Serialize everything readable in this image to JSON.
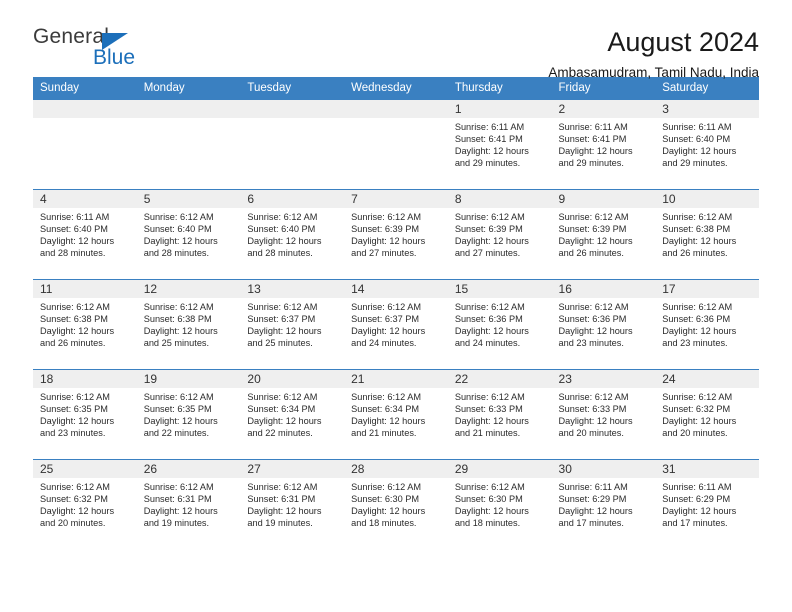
{
  "brand": {
    "name_part1": "General",
    "name_part2": "Blue",
    "accent_color": "#1c6fba"
  },
  "header": {
    "title": "August 2024",
    "location": "Ambasamudram, Tamil Nadu, India"
  },
  "calendar": {
    "header_color": "#3a80c1",
    "weekday_headers": [
      "Sunday",
      "Monday",
      "Tuesday",
      "Wednesday",
      "Thursday",
      "Friday",
      "Saturday"
    ],
    "weeks": [
      [
        {
          "day": "",
          "sunrise": "",
          "sunset": "",
          "daylight1": "",
          "daylight2": ""
        },
        {
          "day": "",
          "sunrise": "",
          "sunset": "",
          "daylight1": "",
          "daylight2": ""
        },
        {
          "day": "",
          "sunrise": "",
          "sunset": "",
          "daylight1": "",
          "daylight2": ""
        },
        {
          "day": "",
          "sunrise": "",
          "sunset": "",
          "daylight1": "",
          "daylight2": ""
        },
        {
          "day": "1",
          "sunrise": "Sunrise: 6:11 AM",
          "sunset": "Sunset: 6:41 PM",
          "daylight1": "Daylight: 12 hours",
          "daylight2": "and 29 minutes."
        },
        {
          "day": "2",
          "sunrise": "Sunrise: 6:11 AM",
          "sunset": "Sunset: 6:41 PM",
          "daylight1": "Daylight: 12 hours",
          "daylight2": "and 29 minutes."
        },
        {
          "day": "3",
          "sunrise": "Sunrise: 6:11 AM",
          "sunset": "Sunset: 6:40 PM",
          "daylight1": "Daylight: 12 hours",
          "daylight2": "and 29 minutes."
        }
      ],
      [
        {
          "day": "4",
          "sunrise": "Sunrise: 6:11 AM",
          "sunset": "Sunset: 6:40 PM",
          "daylight1": "Daylight: 12 hours",
          "daylight2": "and 28 minutes."
        },
        {
          "day": "5",
          "sunrise": "Sunrise: 6:12 AM",
          "sunset": "Sunset: 6:40 PM",
          "daylight1": "Daylight: 12 hours",
          "daylight2": "and 28 minutes."
        },
        {
          "day": "6",
          "sunrise": "Sunrise: 6:12 AM",
          "sunset": "Sunset: 6:40 PM",
          "daylight1": "Daylight: 12 hours",
          "daylight2": "and 28 minutes."
        },
        {
          "day": "7",
          "sunrise": "Sunrise: 6:12 AM",
          "sunset": "Sunset: 6:39 PM",
          "daylight1": "Daylight: 12 hours",
          "daylight2": "and 27 minutes."
        },
        {
          "day": "8",
          "sunrise": "Sunrise: 6:12 AM",
          "sunset": "Sunset: 6:39 PM",
          "daylight1": "Daylight: 12 hours",
          "daylight2": "and 27 minutes."
        },
        {
          "day": "9",
          "sunrise": "Sunrise: 6:12 AM",
          "sunset": "Sunset: 6:39 PM",
          "daylight1": "Daylight: 12 hours",
          "daylight2": "and 26 minutes."
        },
        {
          "day": "10",
          "sunrise": "Sunrise: 6:12 AM",
          "sunset": "Sunset: 6:38 PM",
          "daylight1": "Daylight: 12 hours",
          "daylight2": "and 26 minutes."
        }
      ],
      [
        {
          "day": "11",
          "sunrise": "Sunrise: 6:12 AM",
          "sunset": "Sunset: 6:38 PM",
          "daylight1": "Daylight: 12 hours",
          "daylight2": "and 26 minutes."
        },
        {
          "day": "12",
          "sunrise": "Sunrise: 6:12 AM",
          "sunset": "Sunset: 6:38 PM",
          "daylight1": "Daylight: 12 hours",
          "daylight2": "and 25 minutes."
        },
        {
          "day": "13",
          "sunrise": "Sunrise: 6:12 AM",
          "sunset": "Sunset: 6:37 PM",
          "daylight1": "Daylight: 12 hours",
          "daylight2": "and 25 minutes."
        },
        {
          "day": "14",
          "sunrise": "Sunrise: 6:12 AM",
          "sunset": "Sunset: 6:37 PM",
          "daylight1": "Daylight: 12 hours",
          "daylight2": "and 24 minutes."
        },
        {
          "day": "15",
          "sunrise": "Sunrise: 6:12 AM",
          "sunset": "Sunset: 6:36 PM",
          "daylight1": "Daylight: 12 hours",
          "daylight2": "and 24 minutes."
        },
        {
          "day": "16",
          "sunrise": "Sunrise: 6:12 AM",
          "sunset": "Sunset: 6:36 PM",
          "daylight1": "Daylight: 12 hours",
          "daylight2": "and 23 minutes."
        },
        {
          "day": "17",
          "sunrise": "Sunrise: 6:12 AM",
          "sunset": "Sunset: 6:36 PM",
          "daylight1": "Daylight: 12 hours",
          "daylight2": "and 23 minutes."
        }
      ],
      [
        {
          "day": "18",
          "sunrise": "Sunrise: 6:12 AM",
          "sunset": "Sunset: 6:35 PM",
          "daylight1": "Daylight: 12 hours",
          "daylight2": "and 23 minutes."
        },
        {
          "day": "19",
          "sunrise": "Sunrise: 6:12 AM",
          "sunset": "Sunset: 6:35 PM",
          "daylight1": "Daylight: 12 hours",
          "daylight2": "and 22 minutes."
        },
        {
          "day": "20",
          "sunrise": "Sunrise: 6:12 AM",
          "sunset": "Sunset: 6:34 PM",
          "daylight1": "Daylight: 12 hours",
          "daylight2": "and 22 minutes."
        },
        {
          "day": "21",
          "sunrise": "Sunrise: 6:12 AM",
          "sunset": "Sunset: 6:34 PM",
          "daylight1": "Daylight: 12 hours",
          "daylight2": "and 21 minutes."
        },
        {
          "day": "22",
          "sunrise": "Sunrise: 6:12 AM",
          "sunset": "Sunset: 6:33 PM",
          "daylight1": "Daylight: 12 hours",
          "daylight2": "and 21 minutes."
        },
        {
          "day": "23",
          "sunrise": "Sunrise: 6:12 AM",
          "sunset": "Sunset: 6:33 PM",
          "daylight1": "Daylight: 12 hours",
          "daylight2": "and 20 minutes."
        },
        {
          "day": "24",
          "sunrise": "Sunrise: 6:12 AM",
          "sunset": "Sunset: 6:32 PM",
          "daylight1": "Daylight: 12 hours",
          "daylight2": "and 20 minutes."
        }
      ],
      [
        {
          "day": "25",
          "sunrise": "Sunrise: 6:12 AM",
          "sunset": "Sunset: 6:32 PM",
          "daylight1": "Daylight: 12 hours",
          "daylight2": "and 20 minutes."
        },
        {
          "day": "26",
          "sunrise": "Sunrise: 6:12 AM",
          "sunset": "Sunset: 6:31 PM",
          "daylight1": "Daylight: 12 hours",
          "daylight2": "and 19 minutes."
        },
        {
          "day": "27",
          "sunrise": "Sunrise: 6:12 AM",
          "sunset": "Sunset: 6:31 PM",
          "daylight1": "Daylight: 12 hours",
          "daylight2": "and 19 minutes."
        },
        {
          "day": "28",
          "sunrise": "Sunrise: 6:12 AM",
          "sunset": "Sunset: 6:30 PM",
          "daylight1": "Daylight: 12 hours",
          "daylight2": "and 18 minutes."
        },
        {
          "day": "29",
          "sunrise": "Sunrise: 6:12 AM",
          "sunset": "Sunset: 6:30 PM",
          "daylight1": "Daylight: 12 hours",
          "daylight2": "and 18 minutes."
        },
        {
          "day": "30",
          "sunrise": "Sunrise: 6:11 AM",
          "sunset": "Sunset: 6:29 PM",
          "daylight1": "Daylight: 12 hours",
          "daylight2": "and 17 minutes."
        },
        {
          "day": "31",
          "sunrise": "Sunrise: 6:11 AM",
          "sunset": "Sunset: 6:29 PM",
          "daylight1": "Daylight: 12 hours",
          "daylight2": "and 17 minutes."
        }
      ]
    ]
  }
}
